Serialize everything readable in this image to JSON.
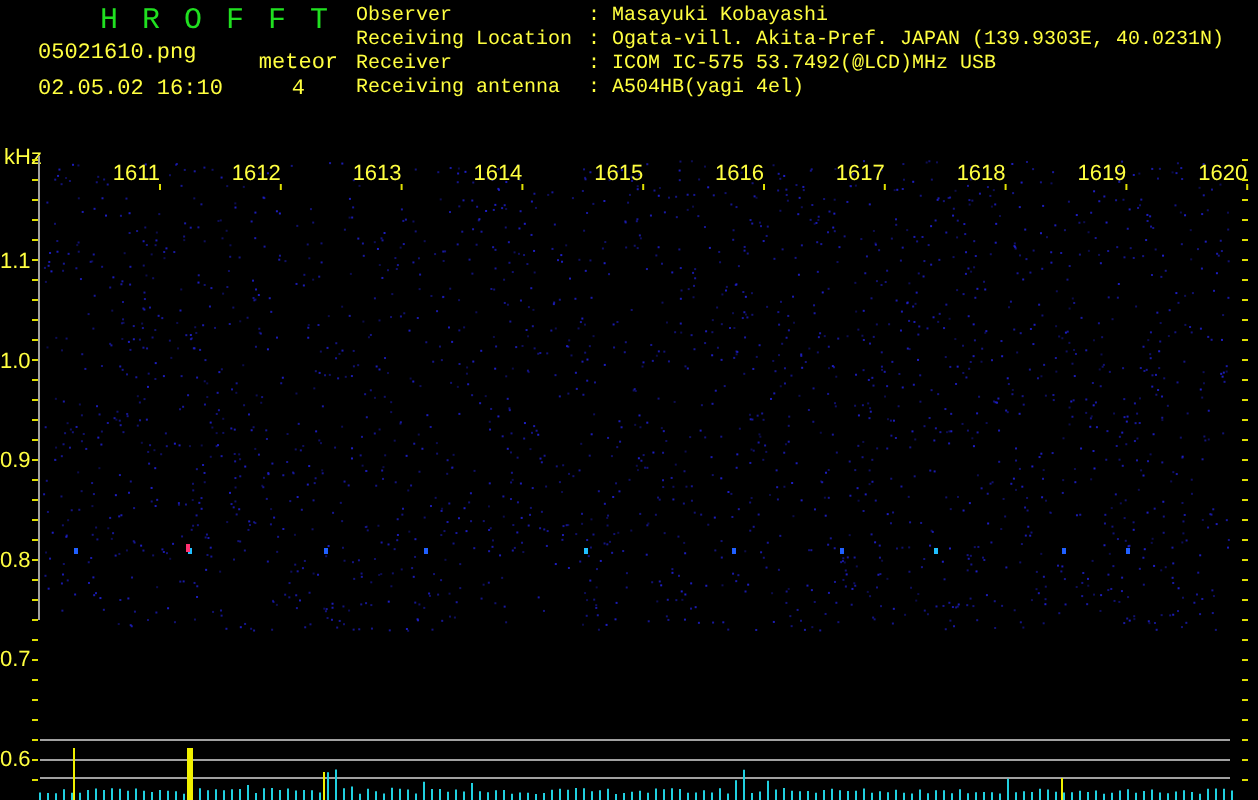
{
  "app_title": "HROFFT",
  "file": {
    "name": "05021610.png",
    "datetime": "02.05.02 16:10"
  },
  "meteor": {
    "label": "meteor",
    "count": "4"
  },
  "info": [
    {
      "label": "Observer",
      "value": ": Masayuki Kobayashi"
    },
    {
      "label": "Receiving Location",
      "value": ": Ogata-vill. Akita-Pref. JAPAN (139.9303E, 40.0231N)"
    },
    {
      "label": "Receiver",
      "value": ": ICOM IC-575 53.7492(@LCD)MHz USB"
    },
    {
      "label": "Receiving antenna",
      "value": ": A504HB(yagi 4el)"
    }
  ],
  "axis": {
    "y_unit": "kHz",
    "y_ticks": [
      "1.1",
      "1.0",
      "0.9",
      "0.8",
      "0.7",
      "0.6"
    ],
    "x_ticks": [
      "1611",
      "1612",
      "1613",
      "1614",
      "1615",
      "1616",
      "1617",
      "1618",
      "1619",
      "1620"
    ]
  }
}
